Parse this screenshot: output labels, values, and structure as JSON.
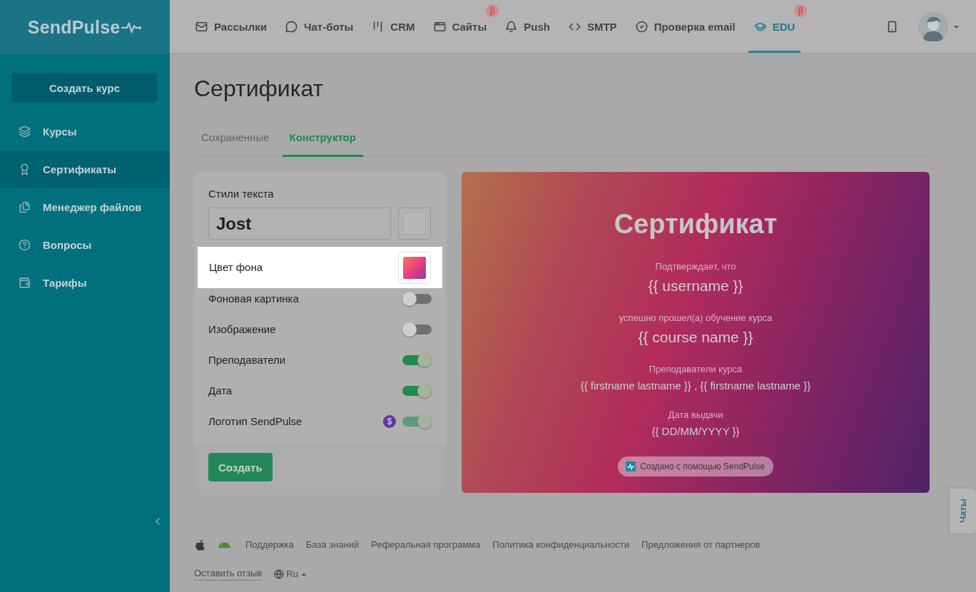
{
  "brand": {
    "name": "SendPulse"
  },
  "nav": {
    "items": [
      {
        "label": "Рассылки",
        "selected": false
      },
      {
        "label": "Чат-боты",
        "selected": false
      },
      {
        "label": "CRM",
        "selected": false
      },
      {
        "label": "Сайты",
        "selected": false,
        "badge": "β"
      },
      {
        "label": "Push",
        "selected": false
      },
      {
        "label": "SMTP",
        "selected": false
      },
      {
        "label": "Проверка email",
        "selected": false
      },
      {
        "label": "EDU",
        "selected": true,
        "badge": "β"
      }
    ]
  },
  "sidebar": {
    "create_button": "Создать курс",
    "items": [
      {
        "label": "Курсы",
        "selected": false
      },
      {
        "label": "Сертификаты",
        "selected": true
      },
      {
        "label": "Менеджер файлов",
        "selected": false
      },
      {
        "label": "Вопросы",
        "selected": false
      },
      {
        "label": "Тарифы",
        "selected": false
      }
    ]
  },
  "page": {
    "title": "Сертификат",
    "tabs": [
      {
        "label": "Сохраненные",
        "selected": false
      },
      {
        "label": "Конструктор",
        "selected": true
      }
    ]
  },
  "settings": {
    "text_styles_label": "Стили текста",
    "font": {
      "value": "Jost"
    },
    "background_color": {
      "label": "Цвет фона",
      "highlighted": true
    },
    "toggles": [
      {
        "label": "Фоновая картинка",
        "on": false,
        "disabled": false
      },
      {
        "label": "Изображение",
        "on": false,
        "disabled": false
      },
      {
        "label": "Преподаватели",
        "on": true,
        "disabled": false
      },
      {
        "label": "Дата",
        "on": true,
        "disabled": false
      },
      {
        "label": "Логотип SendPulse",
        "on": true,
        "disabled": true,
        "badge": "$"
      }
    ],
    "submit_button": "Создать"
  },
  "certificate": {
    "title": "Сертификат",
    "blocks": [
      {
        "kind": "primary",
        "caption": "Подтверждает, что",
        "value": "{{ username }}"
      },
      {
        "kind": "primary",
        "caption": "успешно прошел(а) обучение курса",
        "value": "{{ course name }}"
      },
      {
        "kind": "secondary",
        "caption": "Преподаватели курса",
        "value": "{{ firstname lastname }} , {{ firstname lastname }}"
      },
      {
        "kind": "secondary",
        "caption": "Дата выдачи",
        "value": "{{ DD/MM/YYYY }}"
      }
    ],
    "credit": "Создано с помощью SendPulse"
  },
  "footer": {
    "links": [
      "Поддержка",
      "База знаний",
      "Реферальная программа",
      "Политика конфиденциальности",
      "Предложения от партнеров"
    ],
    "feedback_link": "Оставить отзыв",
    "language": "Ru"
  },
  "chat_tab": {
    "label": "Чаты"
  }
}
